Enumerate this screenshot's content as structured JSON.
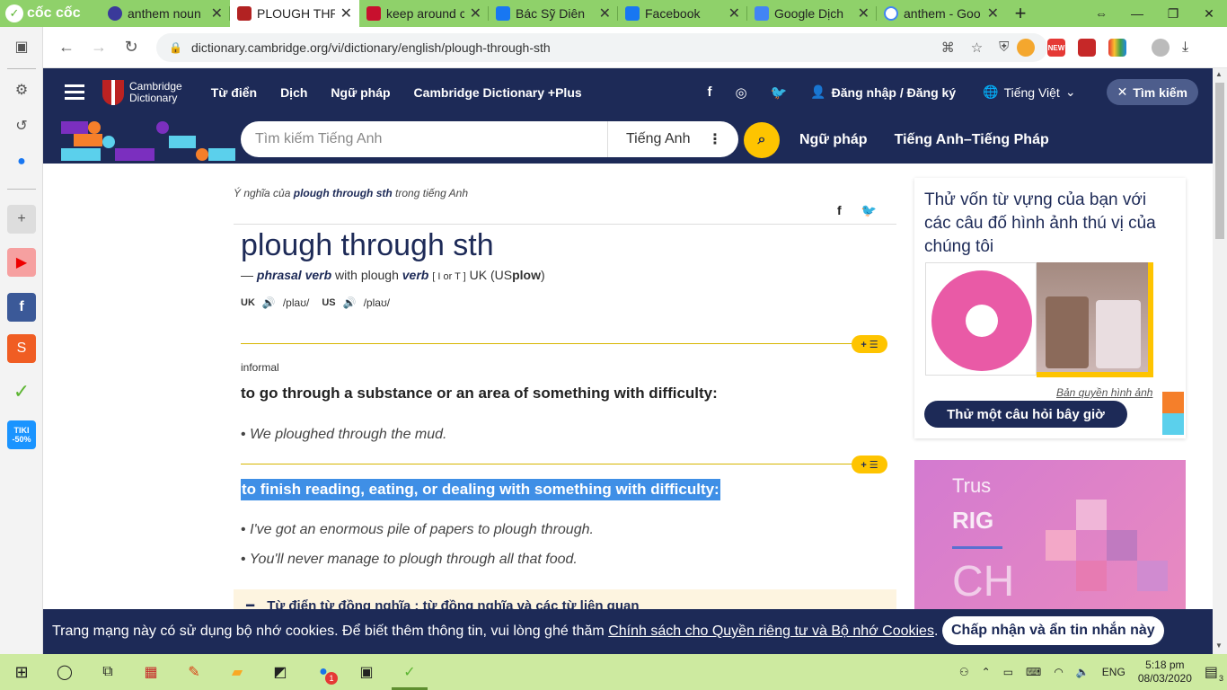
{
  "tabs": [
    {
      "title": "anthem noun",
      "color": "#3a3a9a"
    },
    {
      "title": "PLOUGH THRO",
      "color": "#b22222",
      "active": true
    },
    {
      "title": "keep around c",
      "color": "#c8102e"
    },
    {
      "title": "Bác Sỹ Diên",
      "color": "#1877f2"
    },
    {
      "title": "Facebook",
      "color": "#1877f2"
    },
    {
      "title": "Google Dịch",
      "color": "#4285f4"
    },
    {
      "title": "anthem - Goo",
      "color": "#ffffff"
    }
  ],
  "browser": {
    "brand": "cốc cốc",
    "url": "dictionary.cambridge.org/vi/dictionary/english/plough-through-sth",
    "ext_new": "NEW"
  },
  "header": {
    "logo_line1": "Cambridge",
    "logo_line2": "Dictionary",
    "nav": [
      "Từ điển",
      "Dịch",
      "Ngữ pháp",
      "Cambridge Dictionary +Plus"
    ],
    "social": [
      "f",
      "◎",
      "🐦"
    ],
    "login": "Đăng nhập / Đăng ký",
    "language": "Tiếng Việt",
    "search_toggle": "Tìm kiếm"
  },
  "search": {
    "placeholder": "Tìm kiếm Tiếng Anh",
    "dict": "Tiếng Anh",
    "links": [
      "Ngữ pháp",
      "Tiếng Anh–Tiếng Pháp"
    ]
  },
  "entry": {
    "crumb_pre": "Ý nghĩa của",
    "crumb_word": "plough through sth",
    "crumb_post": "trong tiếng Anh",
    "headword": "plough through sth",
    "dash": "—",
    "pos": "phrasal verb",
    "with": "with plough",
    "verb": "verb",
    "gram": "[ I or T ]",
    "uk_us": "UK (US",
    "us_word": "plow",
    "close_paren": ")",
    "uk_label": "UK",
    "uk_ipa": "/plaʊ/",
    "us_label": "US",
    "us_ipa": "/plaʊ/",
    "register": "informal",
    "plus_label": "+ ☰",
    "senses": [
      {
        "def": "to go through a substance or an area of something with difficulty:",
        "examples": [
          "We ploughed through the mud."
        ]
      },
      {
        "def": "to finish reading, eating, or dealing with something with difficulty:",
        "examples": [
          "I've got an enormous pile of papers to plough through.",
          "You'll never manage to plough through all that food."
        ]
      }
    ],
    "thesaurus": "Từ điển từ đồng nghĩa : từ đồng nghĩa và các từ liên quan",
    "bullet": "•"
  },
  "quiz": {
    "title": "Thử vốn từ vựng của bạn với các câu đố hình ảnh thú vị của chúng tôi",
    "copyright": "Bản quyền hình ảnh",
    "button": "Thử một câu hỏi bây giờ"
  },
  "ad": {
    "t1": "Trus",
    "t2": "RIG",
    "t3": "CH"
  },
  "cookie": {
    "text": "Trang mạng này có sử dụng bộ nhớ cookies. Để biết thêm thông tin, vui lòng ghé thăm",
    "link": "Chính sách cho Quyền riêng tư và Bộ nhớ Cookies",
    "period": ".",
    "accept": "Chấp nhận và ẩn tin nhắn này"
  },
  "taskbar": {
    "lang": "ENG",
    "time": "5:18 pm",
    "date": "08/03/2020",
    "badge": "1",
    "notif": "3"
  },
  "colors": {
    "navy": "#1d2a57",
    "yellow": "#fec400",
    "selection": "#3f8fe6"
  }
}
